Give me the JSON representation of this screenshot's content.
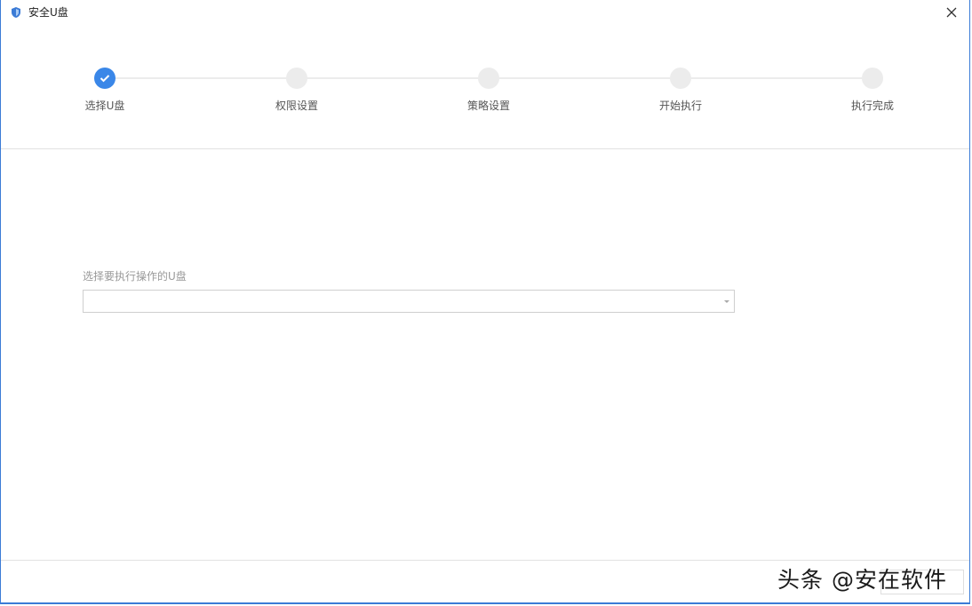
{
  "window": {
    "title": "安全U盘"
  },
  "steps": [
    {
      "label": "选择U盘",
      "state": "done"
    },
    {
      "label": "权限设置",
      "state": "pending"
    },
    {
      "label": "策略设置",
      "state": "pending"
    },
    {
      "label": "开始执行",
      "state": "pending"
    },
    {
      "label": "执行完成",
      "state": "pending"
    }
  ],
  "form": {
    "usb_select_label": "选择要执行操作的U盘",
    "usb_select_value": ""
  },
  "footer": {
    "next_label": ""
  },
  "watermark": {
    "text": "头条 @安在软件"
  },
  "colors": {
    "accent": "#3a87e8",
    "window_border": "#3b7bd6",
    "inactive_step": "#ececec"
  },
  "icons": {
    "app": "shield-app-icon",
    "close": "close-icon",
    "check": "check-icon",
    "dropdown": "chevron-down-icon"
  }
}
